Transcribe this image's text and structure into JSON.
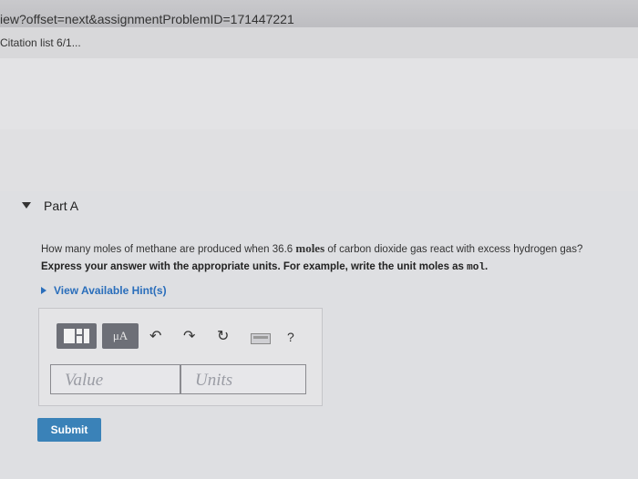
{
  "browser": {
    "url": "iew?offset=next&assignmentProblemID=171447221",
    "tab_label": "Citation list 6/1..."
  },
  "part": {
    "title": "Part A",
    "question_before": "How many moles of methane are produced when 36.6 ",
    "question_bold": "moles",
    "question_after": " of carbon dioxide gas react with excess hydrogen gas?",
    "instruction_text": "Express your answer with the appropriate units. For example, write the unit moles as ",
    "instruction_code": "mol",
    "instruction_end": ".",
    "hint_link": "View Available Hint(s)"
  },
  "toolbar": {
    "template_icon": "template-icon",
    "mu_label": "μA",
    "undo_icon": "undo-icon",
    "redo_icon": "redo-icon",
    "reset_icon": "reset-icon",
    "keyboard_icon": "keyboard-icon",
    "help_label": "?"
  },
  "inputs": {
    "value_placeholder": "Value",
    "units_placeholder": "Units"
  },
  "submit_label": "Submit"
}
